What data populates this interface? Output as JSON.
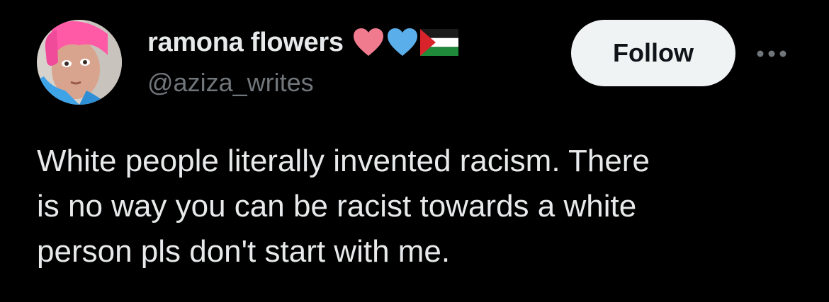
{
  "colors": {
    "background": "#000000",
    "primary_text": "#e7e9ea",
    "secondary_text": "#71767b",
    "follow_button_bg": "#eff3f4",
    "follow_button_text": "#0f1419"
  },
  "author": {
    "display_name": "ramona flowers",
    "handle": "@aziza_writes",
    "avatar_icon": "profile-photo",
    "name_badges": [
      "pink-heart-icon",
      "blue-heart-icon",
      "palestine-flag-icon"
    ]
  },
  "actions": {
    "follow_label": "Follow",
    "more_icon": "ellipsis-icon"
  },
  "tweet": {
    "text": "White people literally invented racism. There\nis no way you can be racist towards a white\nperson pls don't start with me."
  }
}
